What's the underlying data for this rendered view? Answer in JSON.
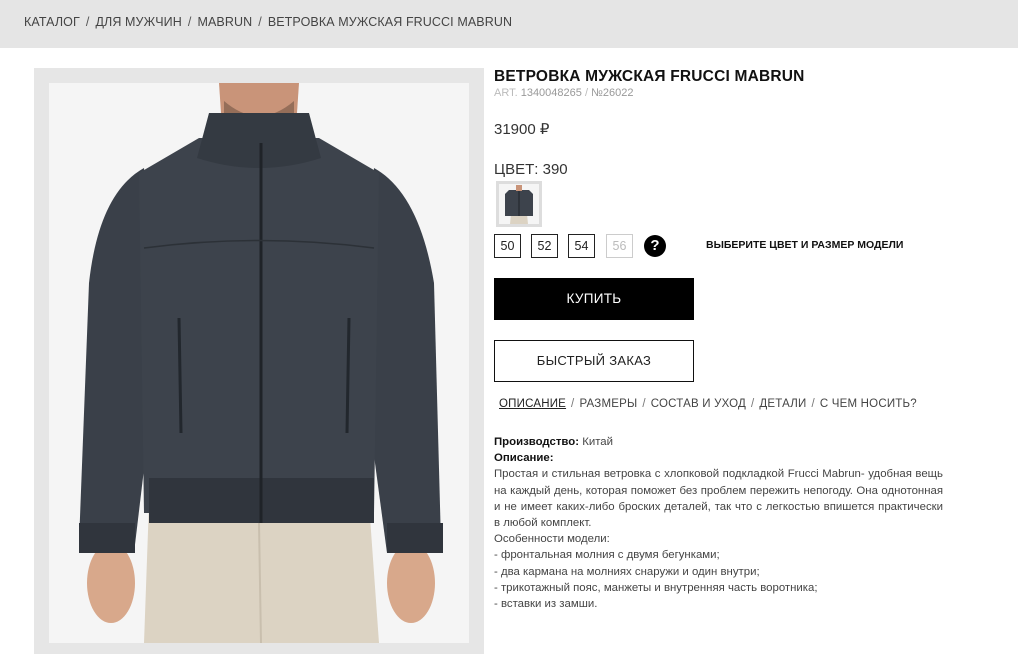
{
  "breadcrumb": {
    "items": [
      "КАТАЛОГ",
      "ДЛЯ МУЖЧИН",
      "MABRUN",
      "ВЕТРОВКА МУЖСКАЯ FRUCCI MABRUN"
    ],
    "separator": "/"
  },
  "product": {
    "title": "ВЕТРОВКА МУЖСКАЯ FRUCCI MABRUN",
    "art_label": "ART.",
    "art_number": "1340048265",
    "art_separator": "/",
    "code": "№26022",
    "price": "31900 ₽",
    "color_label": "ЦВЕТ: 390",
    "sizes": [
      {
        "label": "50",
        "available": true
      },
      {
        "label": "52",
        "available": true
      },
      {
        "label": "54",
        "available": true
      },
      {
        "label": "56",
        "available": false
      }
    ],
    "help_symbol": "?",
    "choose_note": "ВЫБЕРИТЕ ЦВЕТ И РАЗМЕР МОДЕЛИ",
    "buy_label": "КУПИТЬ",
    "quick_order_label": "БЫСТРЫЙ ЗАКАЗ"
  },
  "tabs": {
    "items": [
      "ОПИСАНИЕ",
      "РАЗМЕРЫ",
      "СОСТАВ И УХОД",
      "ДЕТАЛИ",
      "С ЧЕМ НОСИТЬ?"
    ],
    "active": "ОПИСАНИЕ",
    "separator": "/"
  },
  "description": {
    "production_label": "Производство:",
    "production_value": " Китай",
    "desc_label": "Описание:",
    "text": "Простая и стильная ветровка с хлопковой подкладкой Frucci Mabrun- удобная вещь на каждый день, которая поможет без проблем пережить непогоду. Она однотонная и не имеет каких-либо броских деталей, так что с легкостью впишется практически в любой комплект.",
    "features_title": "Особенности модели:",
    "features": [
      "- фронтальная молния с двумя бегунками;",
      "- два кармана на молниях снаружи и один внутри;",
      "- трикотажный пояс, манжеты и внутренняя часть воротника;",
      "- вставки из замши."
    ]
  },
  "icons": {
    "help": "question-circle-icon"
  },
  "colors": {
    "topbar": "#e5e5e5",
    "gallery_frame": "#e6e6e6",
    "jacket": "#3c424b",
    "buy_button": "#000000"
  }
}
